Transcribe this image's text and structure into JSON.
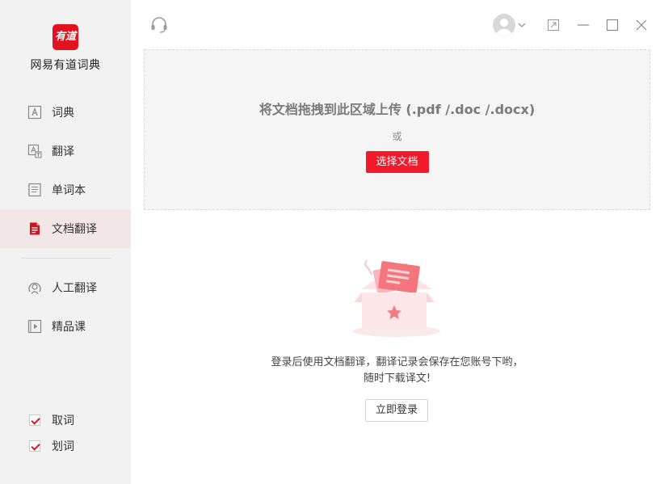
{
  "app": {
    "logo_text": "有道",
    "name": "网易有道词典",
    "brand_color": "#e0131e"
  },
  "sidebar": {
    "items": [
      {
        "label": "词典",
        "icon": "dictionary-icon"
      },
      {
        "label": "翻译",
        "icon": "translate-icon"
      },
      {
        "label": "单词本",
        "icon": "wordbook-icon"
      },
      {
        "label": "文档翻译",
        "icon": "document-icon",
        "active": true
      },
      {
        "label": "人工翻译",
        "icon": "human-translate-icon"
      },
      {
        "label": "精品课",
        "icon": "course-play-icon"
      }
    ],
    "checks": [
      {
        "label": "取词",
        "checked": true
      },
      {
        "label": "划词",
        "checked": true
      }
    ]
  },
  "topbar": {
    "icons": [
      "headset-icon",
      "avatar",
      "chevron-down-icon",
      "restore-icon",
      "minimize-icon",
      "maximize-icon",
      "close-icon"
    ]
  },
  "upload": {
    "title": "将文档拖拽到此区域上传 (.pdf /.doc /.docx)",
    "or_text": "或",
    "select_button": "选择文档"
  },
  "empty_state": {
    "message_line1": "登录后使用文档翻译，翻译记录会保存在您账号下哟，",
    "message_line2": "随时下载译文!",
    "login_button": "立即登录"
  }
}
